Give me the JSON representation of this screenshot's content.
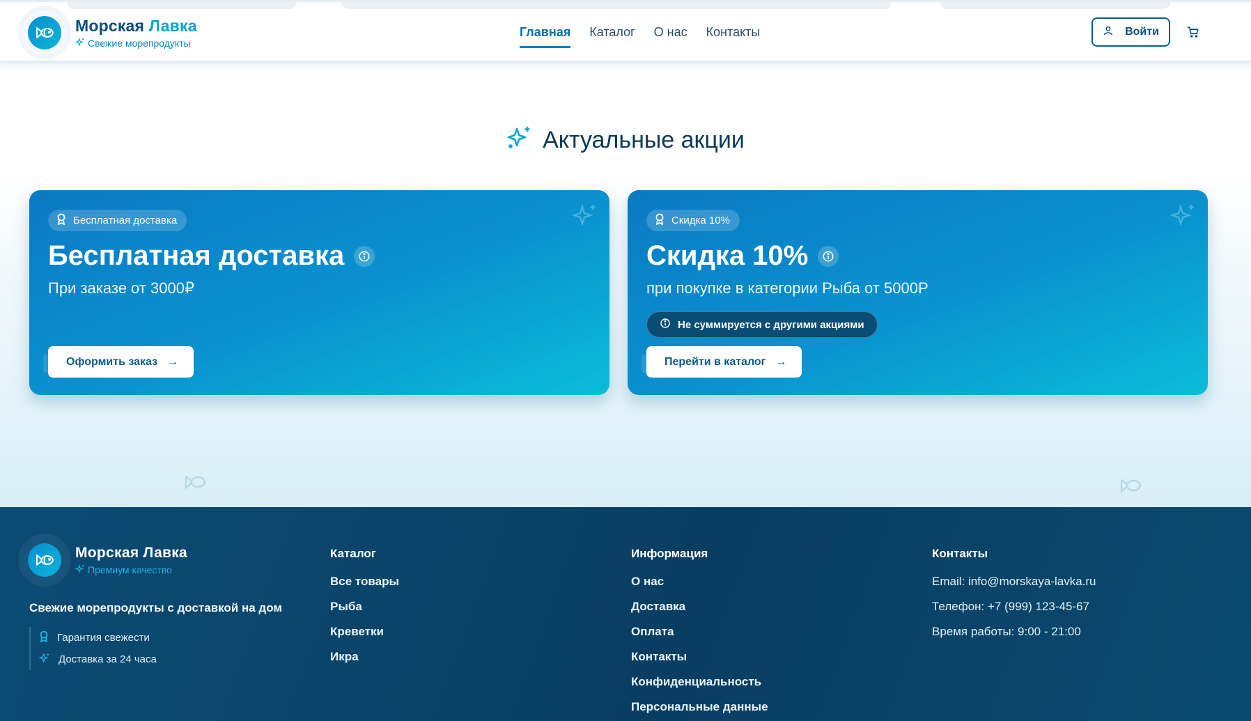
{
  "header": {
    "logo_title_main": "Морская",
    "logo_title_accent": "Лавка",
    "logo_subtitle": "Свежие морепродукты",
    "nav": [
      {
        "label": "Главная",
        "active": true
      },
      {
        "label": "Каталог",
        "active": false
      },
      {
        "label": "О нас",
        "active": false
      },
      {
        "label": "Контакты",
        "active": false
      }
    ],
    "login_label": "Войти"
  },
  "promo": {
    "title": "Актуальные акции",
    "cards": [
      {
        "badge": "Бесплатная доставка",
        "title": "Бесплатная доставка",
        "subtitle": "При заказе от 3000₽",
        "note": "",
        "button": "Оформить заказ",
        "button_arrow": "→"
      },
      {
        "badge": "Скидка 10%",
        "title": "Скидка 10%",
        "subtitle": "при покупке в категории Рыба от 5000Р",
        "note": "Не суммируется с другими акциями",
        "button": "Перейти в каталог",
        "button_arrow": "→"
      }
    ]
  },
  "footer": {
    "logo_title": "Морская Лавка",
    "logo_subtitle": "Премиум качество",
    "description": "Свежие морепродукты с доставкой на дом",
    "features": [
      "Гарантия свежести",
      "Доставка за 24 часа"
    ],
    "catalog": {
      "title": "Каталог",
      "links": [
        "Все товары",
        "Рыба",
        "Креветки",
        "Икра"
      ]
    },
    "info": {
      "title": "Информация",
      "links": [
        "О нас",
        "Доставка",
        "Оплата",
        "Контакты",
        "Конфиденциальность",
        "Персональные данные"
      ]
    },
    "contacts": {
      "title": "Контакты",
      "items": [
        "Email: info@morskaya-lavka.ru",
        "Телефон: +7 (999) 123-45-67",
        "Время работы: 9:00 - 21:00"
      ]
    }
  },
  "colors": {
    "brand_dark": "#0b4b74",
    "accent": "#0aa3cf",
    "card_gradient_start": "#0a79c4",
    "card_gradient_end": "#0abdd8"
  }
}
